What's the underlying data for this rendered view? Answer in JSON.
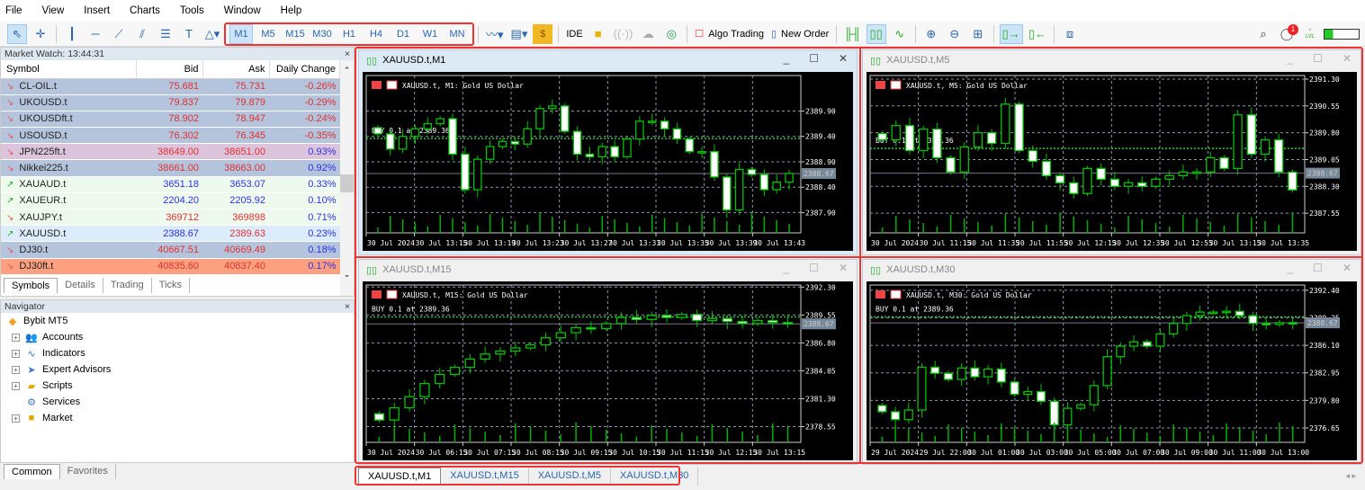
{
  "menu": [
    "File",
    "View",
    "Insert",
    "Charts",
    "Tools",
    "Window",
    "Help"
  ],
  "timeframes": [
    "M1",
    "M5",
    "M15",
    "M30",
    "H1",
    "H4",
    "D1",
    "W1",
    "MN"
  ],
  "active_timeframe": "M1",
  "toolbar": {
    "ide": "IDE",
    "algo_trading": "Algo Trading",
    "new_order": "New Order",
    "notification_count": "1",
    "level_label": "LVL"
  },
  "market_watch": {
    "title": "Market Watch: 13:44:31",
    "columns": [
      "Symbol",
      "Bid",
      "Ask",
      "Daily Change"
    ],
    "rows": [
      {
        "symbol": "CL-OIL.t",
        "bid": "75.681",
        "ask": "75.731",
        "change": "-0.26%",
        "dir": "down",
        "bg": "#b4c4dc",
        "bidc": "#e03030",
        "askc": "#e03030",
        "chc": "#e03030"
      },
      {
        "symbol": "UKOUSD.t",
        "bid": "79.837",
        "ask": "79.879",
        "change": "-0.29%",
        "dir": "down",
        "bg": "#b4c4dc",
        "bidc": "#e03030",
        "askc": "#e03030",
        "chc": "#e03030"
      },
      {
        "symbol": "UKOUSDft.t",
        "bid": "78.902",
        "ask": "78.947",
        "change": "-0.24%",
        "dir": "down",
        "bg": "#b4c4dc",
        "bidc": "#e03030",
        "askc": "#e03030",
        "chc": "#e03030"
      },
      {
        "symbol": "USOUSD.t",
        "bid": "76.302",
        "ask": "76.345",
        "change": "-0.35%",
        "dir": "down",
        "bg": "#b4c4dc",
        "bidc": "#e03030",
        "askc": "#e03030",
        "chc": "#e03030"
      },
      {
        "symbol": "JPN225ft.t",
        "bid": "38649.00",
        "ask": "38651.00",
        "change": "0.93%",
        "dir": "down",
        "bg": "#dcc4dc",
        "bidc": "#e03030",
        "askc": "#e03030",
        "chc": "#3030e0"
      },
      {
        "symbol": "Nikkei225.t",
        "bid": "38661.00",
        "ask": "38663.00",
        "change": "0.92%",
        "dir": "down",
        "bg": "#b4c4dc",
        "bidc": "#e03030",
        "askc": "#e03030",
        "chc": "#3030e0"
      },
      {
        "symbol": "XAUAUD.t",
        "bid": "3651.18",
        "ask": "3653.07",
        "change": "0.33%",
        "dir": "up",
        "bg": "#effaef",
        "bidc": "#3030e0",
        "askc": "#3030e0",
        "chc": "#3030e0"
      },
      {
        "symbol": "XAUEUR.t",
        "bid": "2204.20",
        "ask": "2205.92",
        "change": "0.10%",
        "dir": "up",
        "bg": "#effaef",
        "bidc": "#3030e0",
        "askc": "#3030e0",
        "chc": "#3030e0"
      },
      {
        "symbol": "XAUJPY.t",
        "bid": "369712",
        "ask": "369898",
        "change": "0.71%",
        "dir": "down",
        "bg": "#effaef",
        "bidc": "#e03030",
        "askc": "#e03030",
        "chc": "#3030e0"
      },
      {
        "symbol": "XAUUSD.t",
        "bid": "2388.67",
        "ask": "2389.63",
        "change": "0.23%",
        "dir": "up",
        "bg": "#dcecfc",
        "bidc": "#3030e0",
        "askc": "#e03030",
        "chc": "#3030e0"
      },
      {
        "symbol": "DJ30.t",
        "bid": "40667.51",
        "ask": "40669.49",
        "change": "0.18%",
        "dir": "down",
        "bg": "#b4c4dc",
        "bidc": "#e03030",
        "askc": "#e03030",
        "chc": "#3030e0"
      },
      {
        "symbol": "DJ30ft.t",
        "bid": "40835.60",
        "ask": "40837.40",
        "change": "0.17%",
        "dir": "down",
        "bg": "#fca080",
        "bidc": "#e03030",
        "askc": "#e03030",
        "chc": "#3030e0"
      }
    ],
    "tabs": [
      "Symbols",
      "Details",
      "Trading",
      "Ticks"
    ]
  },
  "navigator": {
    "title": "Navigator",
    "root": "Bybit MT5",
    "items": [
      "Accounts",
      "Indicators",
      "Expert Advisors",
      "Scripts",
      "Services",
      "Market"
    ],
    "tabs": [
      "Common",
      "Favorites"
    ]
  },
  "charts": [
    {
      "title": "XAUUSD.t,M1",
      "label": "XAUUSD.t, M1:  Gold US Dollar",
      "order": "BUY 0.1 at 2389.36",
      "current": "2388.67",
      "yticks": [
        "2389.90",
        "2389.40",
        "2388.90",
        "2388.40",
        "2387.90"
      ],
      "yrange": [
        2387.5,
        2390.6
      ],
      "xticks": [
        "30 Jul 2024",
        "30 Jul 13:15",
        "30 Jul 13:19",
        "30 Jul 13:23",
        "30 Jul 13:27",
        "30 Jul 13:31",
        "30 Jul 13:35",
        "30 Jul 13:39",
        "30 Jul 13:43"
      ],
      "closes": [
        2389.45,
        2389.15,
        2389.4,
        2389.55,
        2389.65,
        2389.75,
        2389.05,
        2388.35,
        2388.95,
        2389.2,
        2389.3,
        2389.25,
        2389.55,
        2389.95,
        2390.0,
        2389.5,
        2389.05,
        2389.0,
        2389.2,
        2389.0,
        2389.35,
        2389.7,
        2389.7,
        2389.55,
        2389.35,
        2389.1,
        2389.1,
        2388.6,
        2387.95,
        2388.75,
        2388.65,
        2388.35,
        2388.5,
        2388.67
      ]
    },
    {
      "title": "XAUUSD.t,M5",
      "label": "XAUUSD.t, M5:  Gold US Dollar",
      "order": "BUY 0.1 at 2389.36",
      "current": "2388.67",
      "yticks": [
        "2391.30",
        "2390.55",
        "2389.80",
        "2389.05",
        "2388.30",
        "2387.55"
      ],
      "yrange": [
        2387.0,
        2391.4
      ],
      "xticks": [
        "30 Jul 2024",
        "30 Jul 11:15",
        "30 Jul 11:35",
        "30 Jul 11:55",
        "30 Jul 12:15",
        "30 Jul 12:35",
        "30 Jul 12:55",
        "30 Jul 13:15",
        "30 Jul 13:35"
      ],
      "closes": [
        2389.6,
        2390.0,
        2389.3,
        2389.9,
        2389.1,
        2388.7,
        2389.4,
        2389.8,
        2389.5,
        2390.6,
        2389.3,
        2389.0,
        2388.6,
        2388.4,
        2388.1,
        2388.8,
        2388.5,
        2388.3,
        2388.4,
        2388.3,
        2388.5,
        2388.6,
        2388.7,
        2388.7,
        2389.1,
        2388.8,
        2390.3,
        2389.2,
        2389.6,
        2388.7,
        2388.2
      ]
    },
    {
      "title": "XAUUSD.t,M15",
      "label": "XAUUSD.t, M15:  Gold US Dollar",
      "order": "BUY 0.1 at 2389.36",
      "current": "2388.67",
      "yticks": [
        "2392.30",
        "2389.55",
        "2386.80",
        "2384.05",
        "2381.30",
        "2378.55"
      ],
      "yrange": [
        2377.0,
        2392.5
      ],
      "xticks": [
        "30 Jul 2024",
        "30 Jul 06:15",
        "30 Jul 07:15",
        "30 Jul 08:15",
        "30 Jul 09:15",
        "30 Jul 10:15",
        "30 Jul 11:15",
        "30 Jul 12:15",
        "30 Jul 13:15"
      ],
      "closes": [
        2379.2,
        2380.4,
        2381.5,
        2382.8,
        2383.7,
        2384.4,
        2385.2,
        2385.7,
        2386.0,
        2386.3,
        2386.6,
        2387.3,
        2387.8,
        2388.3,
        2388.2,
        2388.7,
        2389.3,
        2389.1,
        2389.5,
        2389.3,
        2389.6,
        2389.0,
        2389.2,
        2388.9,
        2388.7,
        2389.0,
        2388.8,
        2388.67
      ]
    },
    {
      "title": "XAUUSD.t,M30",
      "label": "XAUUSD.t, M30:  Gold US Dollar",
      "order": "BUY 0.1 at 2389.36",
      "current": "2388.67",
      "yticks": [
        "2392.40",
        "2389.25",
        "2386.10",
        "2382.95",
        "2379.80",
        "2376.65"
      ],
      "yrange": [
        2375.0,
        2393.0
      ],
      "xticks": [
        "29 Jul 2024",
        "29 Jul 22:00",
        "30 Jul 01:00",
        "30 Jul 03:00",
        "30 Jul 05:00",
        "30 Jul 07:00",
        "30 Jul 09:00",
        "30 Jul 11:00",
        "30 Jul 13:00"
      ],
      "closes": [
        2378.5,
        2377.6,
        2378.7,
        2383.6,
        2382.9,
        2382.2,
        2383.5,
        2382.5,
        2383.4,
        2381.9,
        2380.5,
        2380.8,
        2379.7,
        2377.0,
        2378.9,
        2379.3,
        2381.5,
        2384.8,
        2386.0,
        2386.5,
        2386.0,
        2387.4,
        2388.6,
        2389.5,
        2389.9,
        2389.9,
        2390.0,
        2389.5,
        2388.6,
        2388.5,
        2388.7,
        2388.67
      ]
    }
  ],
  "chart_tabs": [
    "XAUUSD.t,M1",
    "XAUUSD.t,M15",
    "XAUUSD.t,M5",
    "XAUUSD.t,M30"
  ],
  "colors": {
    "bull": "#00c000",
    "bear": "#ffffff",
    "grid": "#8899aa",
    "highlight": "#e33333"
  }
}
